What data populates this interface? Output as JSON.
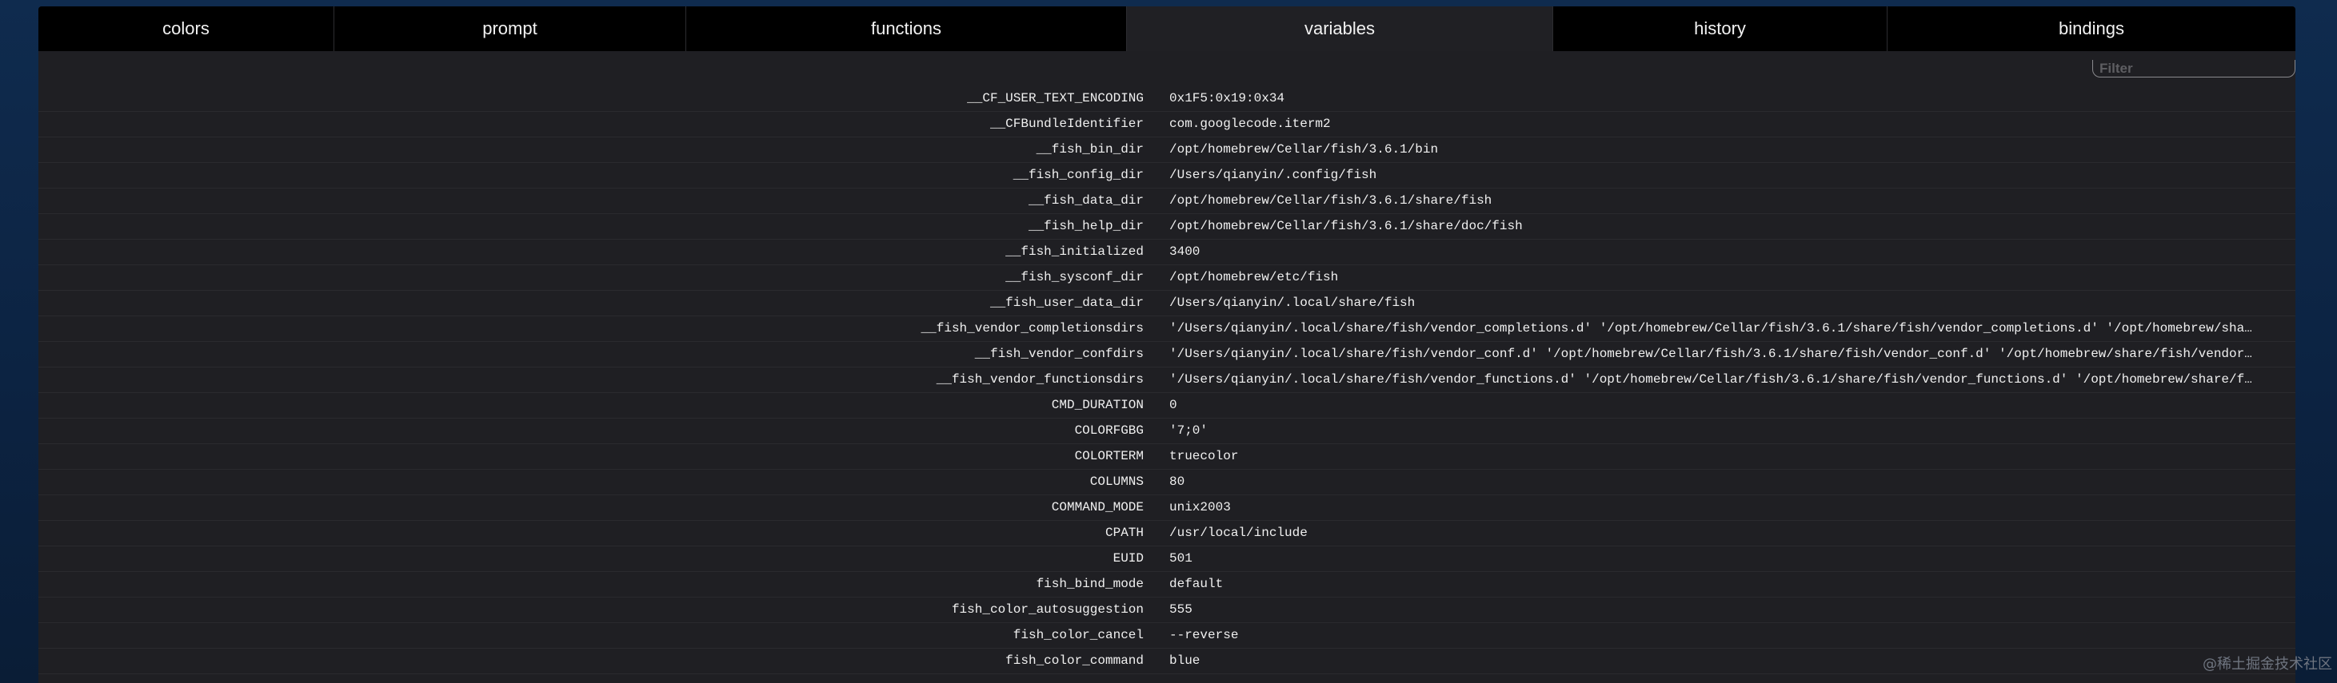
{
  "tabs": [
    {
      "label": "colors",
      "active": false
    },
    {
      "label": "prompt",
      "active": false
    },
    {
      "label": "functions",
      "active": false
    },
    {
      "label": "variables",
      "active": true
    },
    {
      "label": "history",
      "active": false
    },
    {
      "label": "bindings",
      "active": false
    }
  ],
  "filter": {
    "placeholder": "Filter",
    "value": ""
  },
  "variables": [
    {
      "name": "__CF_USER_TEXT_ENCODING",
      "value": "0x1F5:0x19:0x34"
    },
    {
      "name": "__CFBundleIdentifier",
      "value": "com.googlecode.iterm2"
    },
    {
      "name": "__fish_bin_dir",
      "value": "/opt/homebrew/Cellar/fish/3.6.1/bin"
    },
    {
      "name": "__fish_config_dir",
      "value": "/Users/qianyin/.config/fish"
    },
    {
      "name": "__fish_data_dir",
      "value": "/opt/homebrew/Cellar/fish/3.6.1/share/fish"
    },
    {
      "name": "__fish_help_dir",
      "value": "/opt/homebrew/Cellar/fish/3.6.1/share/doc/fish"
    },
    {
      "name": "__fish_initialized",
      "value": "3400"
    },
    {
      "name": "__fish_sysconf_dir",
      "value": "/opt/homebrew/etc/fish"
    },
    {
      "name": "__fish_user_data_dir",
      "value": "/Users/qianyin/.local/share/fish"
    },
    {
      "name": "__fish_vendor_completionsdirs",
      "value": "'/Users/qianyin/.local/share/fish/vendor_completions.d' '/opt/homebrew/Cellar/fish/3.6.1/share/fish/vendor_completions.d' '/opt/homebrew/sha…"
    },
    {
      "name": "__fish_vendor_confdirs",
      "value": "'/Users/qianyin/.local/share/fish/vendor_conf.d' '/opt/homebrew/Cellar/fish/3.6.1/share/fish/vendor_conf.d' '/opt/homebrew/share/fish/vendor…"
    },
    {
      "name": "__fish_vendor_functionsdirs",
      "value": "'/Users/qianyin/.local/share/fish/vendor_functions.d' '/opt/homebrew/Cellar/fish/3.6.1/share/fish/vendor_functions.d' '/opt/homebrew/share/f…"
    },
    {
      "name": "CMD_DURATION",
      "value": "0"
    },
    {
      "name": "COLORFGBG",
      "value": "'7;0'"
    },
    {
      "name": "COLORTERM",
      "value": "truecolor"
    },
    {
      "name": "COLUMNS",
      "value": "80"
    },
    {
      "name": "COMMAND_MODE",
      "value": "unix2003"
    },
    {
      "name": "CPATH",
      "value": "/usr/local/include"
    },
    {
      "name": "EUID",
      "value": "501"
    },
    {
      "name": "fish_bind_mode",
      "value": "default"
    },
    {
      "name": "fish_color_autosuggestion",
      "value": "555"
    },
    {
      "name": "fish_color_cancel",
      "value": "--reverse"
    },
    {
      "name": "fish_color_command",
      "value": "blue"
    }
  ],
  "watermark": "@稀土掘金技术社区",
  "colors": {
    "background": "#0c2342",
    "panel": "#1f1f23",
    "tabbar": "#000000",
    "active_tab": "#202024",
    "text": "#f0f0f0"
  }
}
